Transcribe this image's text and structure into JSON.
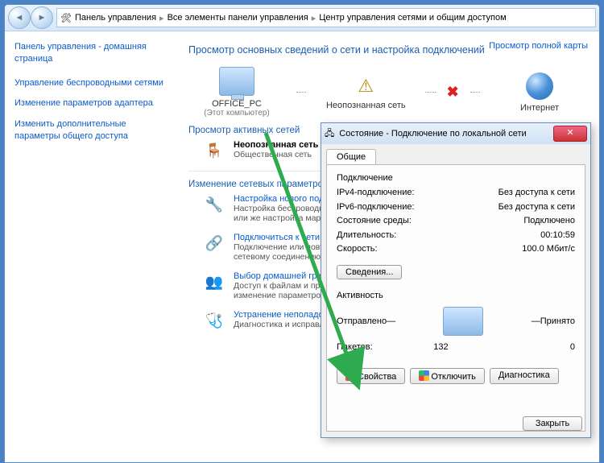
{
  "breadcrumb": {
    "a": "Панель управления",
    "b": "Все элементы панели управления",
    "c": "Центр управления сетями и общим доступом"
  },
  "sidebar": {
    "home": "Панель управления - домашняя страница",
    "links": [
      "Управление беспроводными сетями",
      "Изменение параметров адаптера",
      "Изменить дополнительные параметры общего доступа"
    ]
  },
  "main": {
    "heading": "Просмотр основных сведений о сети и настройка подключений",
    "mapLink": "Просмотр полной карты",
    "node1": {
      "label": "OFFICE_PC",
      "sub": "(Этот компьютер)"
    },
    "node2": {
      "label": "Неопознанная сеть"
    },
    "node3": {
      "label": "Интернет"
    },
    "sect1": "Просмотр активных сетей",
    "active": {
      "title": "Неопознанная сеть",
      "sub": "Общественная сеть"
    },
    "sect2": "Изменение сетевых параметров",
    "items": [
      {
        "title": "Настройка нового подключения или сети",
        "desc": "Настройка беспроводного, широкополосного, модемного, прямого или VPN-подключения или же настройка маршрутизатора или точки доступа."
      },
      {
        "title": "Подключиться к сети",
        "desc": "Подключение или повторное подключение к беспроводному, проводному, модемному сетевому соединению или подключение к VPN."
      },
      {
        "title": "Выбор домашней группы и параметров общего доступа",
        "desc": "Доступ к файлам и принтерам, расположенным на других сетевых компьютерах, или изменение параметров общего доступа."
      },
      {
        "title": "Устранение неполадок",
        "desc": "Диагностика и исправление сетевых проблем или получение сведений об исправлении."
      }
    ]
  },
  "dialog": {
    "title": "Состояние - Подключение по локальной сети",
    "tab": "Общие",
    "group1": "Подключение",
    "rows": [
      {
        "k": "IPv4-подключение:",
        "v": "Без доступа к сети"
      },
      {
        "k": "IPv6-подключение:",
        "v": "Без доступа к сети"
      },
      {
        "k": "Состояние среды:",
        "v": "Подключено"
      },
      {
        "k": "Длительность:",
        "v": "00:10:59"
      },
      {
        "k": "Скорость:",
        "v": "100.0 Мбит/с"
      }
    ],
    "details": "Сведения...",
    "group2": "Активность",
    "sent": "Отправлено",
    "recv": "Принято",
    "packets": "Пакетов:",
    "pSent": "132",
    "pRecv": "0",
    "btnProps": "Свойства",
    "btnDisable": "Отключить",
    "btnDiag": "Диагностика",
    "close": "Закрыть"
  }
}
